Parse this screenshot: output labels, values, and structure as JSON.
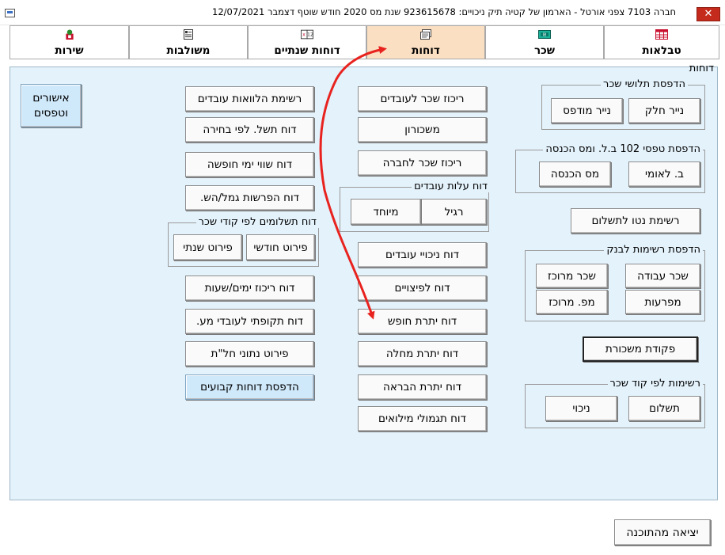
{
  "window": {
    "title": "חברה 7103 צפני אורטל - הארמון של קטיה  תיק ניכויים: 923615678   שנת מס 2020   חודש שוטף דצמבר        12/07/2021",
    "close": "✕"
  },
  "tabs": [
    {
      "label": "טבלאות",
      "icon": "table-icon",
      "color": "#c8102e"
    },
    {
      "label": "שכר",
      "icon": "payroll-icon",
      "color": "#0a7a6a"
    },
    {
      "label": "דוחות",
      "icon": "reports-icon",
      "color": "#555555",
      "active": true
    },
    {
      "label": "דוחות שנתיים",
      "icon": "annual-reports-icon",
      "color": "#333333"
    },
    {
      "label": "משולבות",
      "icon": "combined-icon",
      "color": "#333333"
    },
    {
      "label": "שירות",
      "icon": "service-icon",
      "color": "#2a8a2a"
    }
  ],
  "panel": {
    "title": "דוחות",
    "groups": {
      "pay_slips": {
        "label": "הדפסת תלושי שכר",
        "buttons": [
          "נייר חלק",
          "נייר מודפס"
        ]
      },
      "forms_102": {
        "label": "הדפסת טפסי 102 ב.ל. ומס הכנסה",
        "buttons": [
          "ב. לאומי",
          "מס הכנסה"
        ]
      },
      "bank_lists": {
        "label": "הדפסת רשימות לבנק",
        "buttons": [
          "שכר עבודה",
          "שכר מרוכז",
          "מפרעות",
          "מפ. מרוכז"
        ]
      },
      "by_code": {
        "label": "רשימות לפי קוד שכר",
        "buttons": [
          "תשלום",
          "ניכוי"
        ]
      },
      "employee_cost": {
        "label": "דוח עלות עובדים",
        "buttons": [
          "רגיל",
          "מיוחד"
        ]
      },
      "payments_by_code": {
        "label": "דוח תשלומים לפי קודי שכר",
        "buttons": [
          "פירוט חודשי",
          "פירוט שנתי"
        ]
      }
    },
    "right_buttons": {
      "net_list": "רשימת נטו לתשלום",
      "payroll_order": "פקודת משכורת"
    },
    "middle_buttons": [
      "ריכוז שכר לעובדים",
      "משכורון",
      "ריכוז שכר לחברה",
      "דוח ניכויי עובדים",
      "דוח לפיצויים",
      "דוח יתרת חופש",
      "דוח יתרת מחלה",
      "דוח יתרת הבראה",
      "דוח תגמולי מילואים"
    ],
    "left_buttons": [
      "רשימת הלוואות עובדים",
      "דוח תשל. לפי בחירה",
      "דוח שווי ימי חופשה",
      "דוח הפרשות גמל/הש.",
      "דוח ריכוז ימים/שעות",
      "דוח תקופתי לעובדי מע.",
      "פירוט נתוני חל\"ת",
      "הדפסת דוחות קבועים"
    ],
    "approvals": "אישורים\nוטפסים"
  },
  "footer": {
    "exit": "יציאה מהתוכנה"
  },
  "annotation": {
    "color": "#e8231f"
  }
}
